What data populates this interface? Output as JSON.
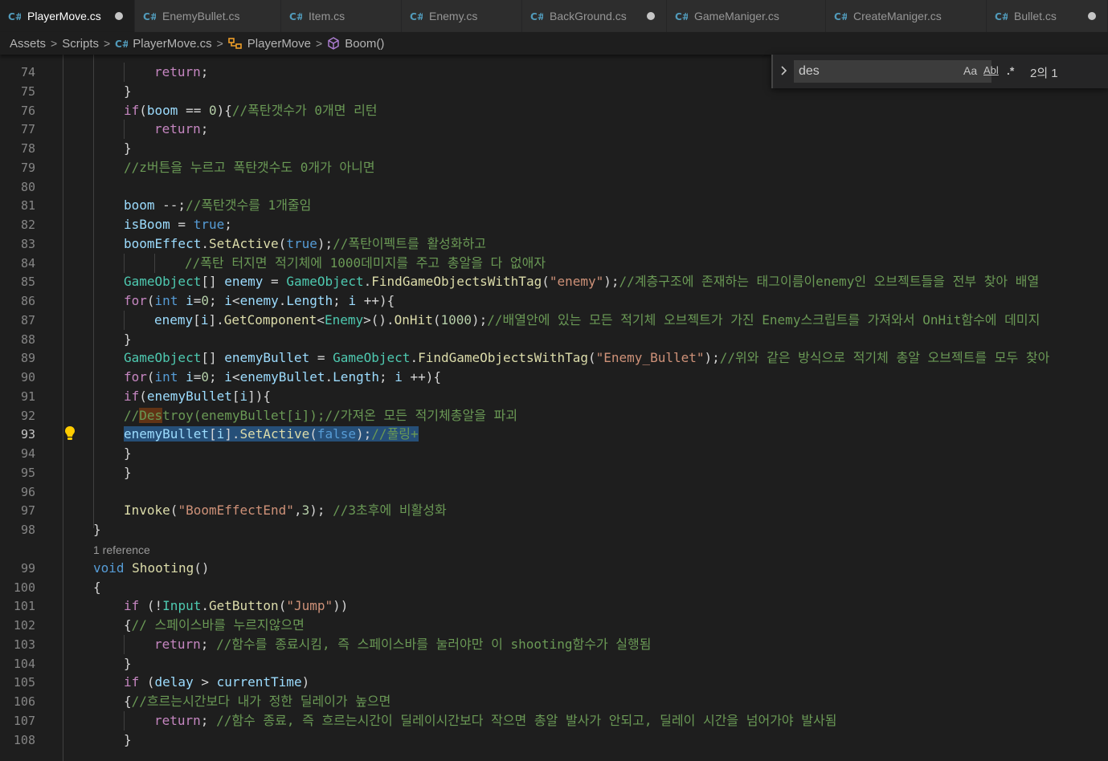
{
  "tabs": [
    {
      "label": "PlayerMove.cs",
      "active": true,
      "modified": true
    },
    {
      "label": "EnemyBullet.cs",
      "active": false,
      "modified": false
    },
    {
      "label": "Item.cs",
      "active": false,
      "modified": false
    },
    {
      "label": "Enemy.cs",
      "active": false,
      "modified": false
    },
    {
      "label": "BackGround.cs",
      "active": false,
      "modified": true
    },
    {
      "label": "GameManiger.cs",
      "active": false,
      "modified": false
    },
    {
      "label": "CreateManiger.cs",
      "active": false,
      "modified": false
    },
    {
      "label": "Bullet.cs",
      "active": false,
      "modified": true
    }
  ],
  "breadcrumb": {
    "assets": "Assets",
    "scripts": "Scripts",
    "file": "PlayerMove.cs",
    "class": "PlayerMove",
    "method": "Boom()"
  },
  "find": {
    "query": "des",
    "match_case": "Aa",
    "whole_word": "Abl",
    "regex": ".*",
    "result": "2의 1"
  },
  "colors": {
    "background": "#1e1e1e",
    "keyword": "#569cd6",
    "control": "#c586c0",
    "type": "#4ec9b0",
    "function": "#dcdcaa",
    "variable": "#9cdcfe",
    "string": "#ce9178",
    "number": "#b5cea8",
    "comment": "#6a9955",
    "selection": "#264f78"
  },
  "current_line": 93,
  "codelens": "1 reference",
  "lines": [
    {
      "n": "74",
      "indent": 2,
      "tokens": [
        [
          "kc",
          "return"
        ],
        [
          "p",
          ";"
        ]
      ]
    },
    {
      "n": "75",
      "indent": 1,
      "tokens": [
        [
          "p",
          "}"
        ]
      ]
    },
    {
      "n": "76",
      "indent": 1,
      "tokens": [
        [
          "kc",
          "if"
        ],
        [
          "p",
          "("
        ],
        [
          "v",
          "boom"
        ],
        [
          "p",
          " == "
        ],
        [
          "n",
          "0"
        ],
        [
          "p",
          "){"
        ],
        [
          "c",
          "//폭탄갯수가 0개면 리턴"
        ]
      ]
    },
    {
      "n": "77",
      "indent": 2,
      "tokens": [
        [
          "kc",
          "return"
        ],
        [
          "p",
          ";"
        ]
      ]
    },
    {
      "n": "78",
      "indent": 1,
      "tokens": [
        [
          "p",
          "}"
        ]
      ]
    },
    {
      "n": "79",
      "indent": 1,
      "tokens": [
        [
          "c",
          "//z버튼을 누르고 폭탄갯수도 0개가 아니면"
        ]
      ]
    },
    {
      "n": "80",
      "indent": 0,
      "tokens": []
    },
    {
      "n": "81",
      "indent": 1,
      "tokens": [
        [
          "v",
          "boom"
        ],
        [
          "p",
          " --;"
        ],
        [
          "c",
          "//폭탄갯수를 1개줄임"
        ]
      ]
    },
    {
      "n": "82",
      "indent": 1,
      "tokens": [
        [
          "v",
          "isBoom"
        ],
        [
          "p",
          " = "
        ],
        [
          "k",
          "true"
        ],
        [
          "p",
          ";"
        ]
      ]
    },
    {
      "n": "83",
      "indent": 1,
      "tokens": [
        [
          "v",
          "boomEffect"
        ],
        [
          "p",
          "."
        ],
        [
          "f",
          "SetActive"
        ],
        [
          "p",
          "("
        ],
        [
          "k",
          "true"
        ],
        [
          "p",
          ");"
        ],
        [
          "c",
          "//폭탄이펙트를 활성화하고"
        ]
      ]
    },
    {
      "n": "84",
      "indent": 3,
      "tokens": [
        [
          "c",
          "//폭탄 터지면 적기체에 1000데미지를 주고 총알을 다 없애자"
        ]
      ]
    },
    {
      "n": "85",
      "indent": 1,
      "tokens": [
        [
          "t",
          "GameObject"
        ],
        [
          "p",
          "[] "
        ],
        [
          "v",
          "enemy"
        ],
        [
          "p",
          " = "
        ],
        [
          "t",
          "GameObject"
        ],
        [
          "p",
          "."
        ],
        [
          "f",
          "FindGameObjectsWithTag"
        ],
        [
          "p",
          "("
        ],
        [
          "s",
          "\"enemy\""
        ],
        [
          "p",
          ");"
        ],
        [
          "c",
          "//계층구조에 존재하는 태그이름이enemy인 오브젝트들을 전부 찾아 배열"
        ]
      ]
    },
    {
      "n": "86",
      "indent": 1,
      "tokens": [
        [
          "kc",
          "for"
        ],
        [
          "p",
          "("
        ],
        [
          "k",
          "int"
        ],
        [
          "p",
          " "
        ],
        [
          "v",
          "i"
        ],
        [
          "p",
          "="
        ],
        [
          "n",
          "0"
        ],
        [
          "p",
          "; "
        ],
        [
          "v",
          "i"
        ],
        [
          "p",
          "<"
        ],
        [
          "v",
          "enemy"
        ],
        [
          "p",
          "."
        ],
        [
          "v",
          "Length"
        ],
        [
          "p",
          "; "
        ],
        [
          "v",
          "i"
        ],
        [
          "p",
          " ++){"
        ]
      ]
    },
    {
      "n": "87",
      "indent": 2,
      "tokens": [
        [
          "v",
          "enemy"
        ],
        [
          "p",
          "["
        ],
        [
          "v",
          "i"
        ],
        [
          "p",
          "]."
        ],
        [
          "f",
          "GetComponent"
        ],
        [
          "p",
          "<"
        ],
        [
          "t",
          "Enemy"
        ],
        [
          "p",
          ">()."
        ],
        [
          "f",
          "OnHit"
        ],
        [
          "p",
          "("
        ],
        [
          "n",
          "1000"
        ],
        [
          "p",
          ");"
        ],
        [
          "c",
          "//배열안에 있는 모든 적기체 오브젝트가 가진 Enemy스크립트를 가져와서 OnHit함수에 데미지"
        ]
      ]
    },
    {
      "n": "88",
      "indent": 1,
      "tokens": [
        [
          "p",
          "}"
        ]
      ]
    },
    {
      "n": "89",
      "indent": 1,
      "tokens": [
        [
          "t",
          "GameObject"
        ],
        [
          "p",
          "[] "
        ],
        [
          "v",
          "enemyBullet"
        ],
        [
          "p",
          " = "
        ],
        [
          "t",
          "GameObject"
        ],
        [
          "p",
          "."
        ],
        [
          "f",
          "FindGameObjectsWithTag"
        ],
        [
          "p",
          "("
        ],
        [
          "s",
          "\"Enemy_Bullet\""
        ],
        [
          "p",
          ");"
        ],
        [
          "c",
          "//위와 같은 방식으로 적기체 총알 오브젝트를 모두 찾아"
        ]
      ]
    },
    {
      "n": "90",
      "indent": 1,
      "tokens": [
        [
          "kc",
          "for"
        ],
        [
          "p",
          "("
        ],
        [
          "k",
          "int"
        ],
        [
          "p",
          " "
        ],
        [
          "v",
          "i"
        ],
        [
          "p",
          "="
        ],
        [
          "n",
          "0"
        ],
        [
          "p",
          "; "
        ],
        [
          "v",
          "i"
        ],
        [
          "p",
          "<"
        ],
        [
          "v",
          "enemyBullet"
        ],
        [
          "p",
          "."
        ],
        [
          "v",
          "Length"
        ],
        [
          "p",
          "; "
        ],
        [
          "v",
          "i"
        ],
        [
          "p",
          " ++){"
        ]
      ]
    },
    {
      "n": "91",
      "indent": 1,
      "tokens": [
        [
          "kc",
          "if"
        ],
        [
          "p",
          "("
        ],
        [
          "v",
          "enemyBullet"
        ],
        [
          "p",
          "["
        ],
        [
          "v",
          "i"
        ],
        [
          "p",
          "]){"
        ]
      ]
    },
    {
      "n": "92",
      "indent": 1,
      "tokens": [
        [
          "c",
          "//"
        ],
        [
          "c hl",
          "Des"
        ],
        [
          "c",
          "troy(enemyBullet[i]);//가져온 모든 적기체총알을 파괴"
        ]
      ]
    },
    {
      "n": "93",
      "indent": 1,
      "tokens": [
        [
          "v sel",
          "enemyBullet"
        ],
        [
          "p sel",
          "["
        ],
        [
          "v sel",
          "i"
        ],
        [
          "p sel",
          "]."
        ],
        [
          "f sel",
          "SetActive"
        ],
        [
          "p sel",
          "("
        ],
        [
          "k sel",
          "false"
        ],
        [
          "p sel",
          ");"
        ],
        [
          "c sel",
          "//풀링+"
        ]
      ]
    },
    {
      "n": "94",
      "indent": 1,
      "tokens": [
        [
          "p",
          "}"
        ]
      ]
    },
    {
      "n": "95",
      "indent": 1,
      "tokens": [
        [
          "p",
          "}"
        ]
      ]
    },
    {
      "n": "96",
      "indent": 0,
      "tokens": []
    },
    {
      "n": "97",
      "indent": 1,
      "tokens": [
        [
          "f",
          "Invoke"
        ],
        [
          "p",
          "("
        ],
        [
          "s",
          "\"BoomEffectEnd\""
        ],
        [
          "p",
          ","
        ],
        [
          "n",
          "3"
        ],
        [
          "p",
          "); "
        ],
        [
          "c",
          "//3초후에 비활성화"
        ]
      ]
    },
    {
      "n": "98",
      "indent": 0,
      "tokens": [
        [
          "p",
          "}"
        ]
      ]
    },
    {
      "n": "99",
      "indent": 0,
      "tokens": [
        [
          "k",
          "void"
        ],
        [
          "p",
          " "
        ],
        [
          "f",
          "Shooting"
        ],
        [
          "p",
          "()"
        ]
      ]
    },
    {
      "n": "100",
      "indent": 0,
      "tokens": [
        [
          "p",
          "{"
        ]
      ]
    },
    {
      "n": "101",
      "indent": 1,
      "tokens": [
        [
          "kc",
          "if"
        ],
        [
          "p",
          " (!"
        ],
        [
          "t",
          "Input"
        ],
        [
          "p",
          "."
        ],
        [
          "f",
          "GetButton"
        ],
        [
          "p",
          "("
        ],
        [
          "s",
          "\"Jump\""
        ],
        [
          "p",
          "))"
        ]
      ]
    },
    {
      "n": "102",
      "indent": 1,
      "tokens": [
        [
          "p",
          "{"
        ],
        [
          "c",
          "// 스페이스바를 누르지않으면"
        ]
      ]
    },
    {
      "n": "103",
      "indent": 2,
      "tokens": [
        [
          "kc",
          "return"
        ],
        [
          "p",
          "; "
        ],
        [
          "c",
          "//함수를 종료시킴, 즉 스페이스바를 눌러야만 이 shooting함수가 실행됨"
        ]
      ]
    },
    {
      "n": "104",
      "indent": 1,
      "tokens": [
        [
          "p",
          "}"
        ]
      ]
    },
    {
      "n": "105",
      "indent": 1,
      "tokens": [
        [
          "kc",
          "if"
        ],
        [
          "p",
          " ("
        ],
        [
          "v",
          "delay"
        ],
        [
          "p",
          " > "
        ],
        [
          "v",
          "currentTime"
        ],
        [
          "p",
          ")"
        ]
      ]
    },
    {
      "n": "106",
      "indent": 1,
      "tokens": [
        [
          "p",
          "{"
        ],
        [
          "c",
          "//흐르는시간보다 내가 정한 딜레이가 높으면"
        ]
      ]
    },
    {
      "n": "107",
      "indent": 2,
      "tokens": [
        [
          "kc",
          "return"
        ],
        [
          "p",
          "; "
        ],
        [
          "c",
          "//함수 종료, 즉 흐르는시간이 딜레이시간보다 작으면 총알 발사가 안되고, 딜레이 시간을 넘어가야 발사됨"
        ]
      ]
    },
    {
      "n": "108",
      "indent": 1,
      "tokens": [
        [
          "p",
          "}"
        ]
      ]
    }
  ]
}
